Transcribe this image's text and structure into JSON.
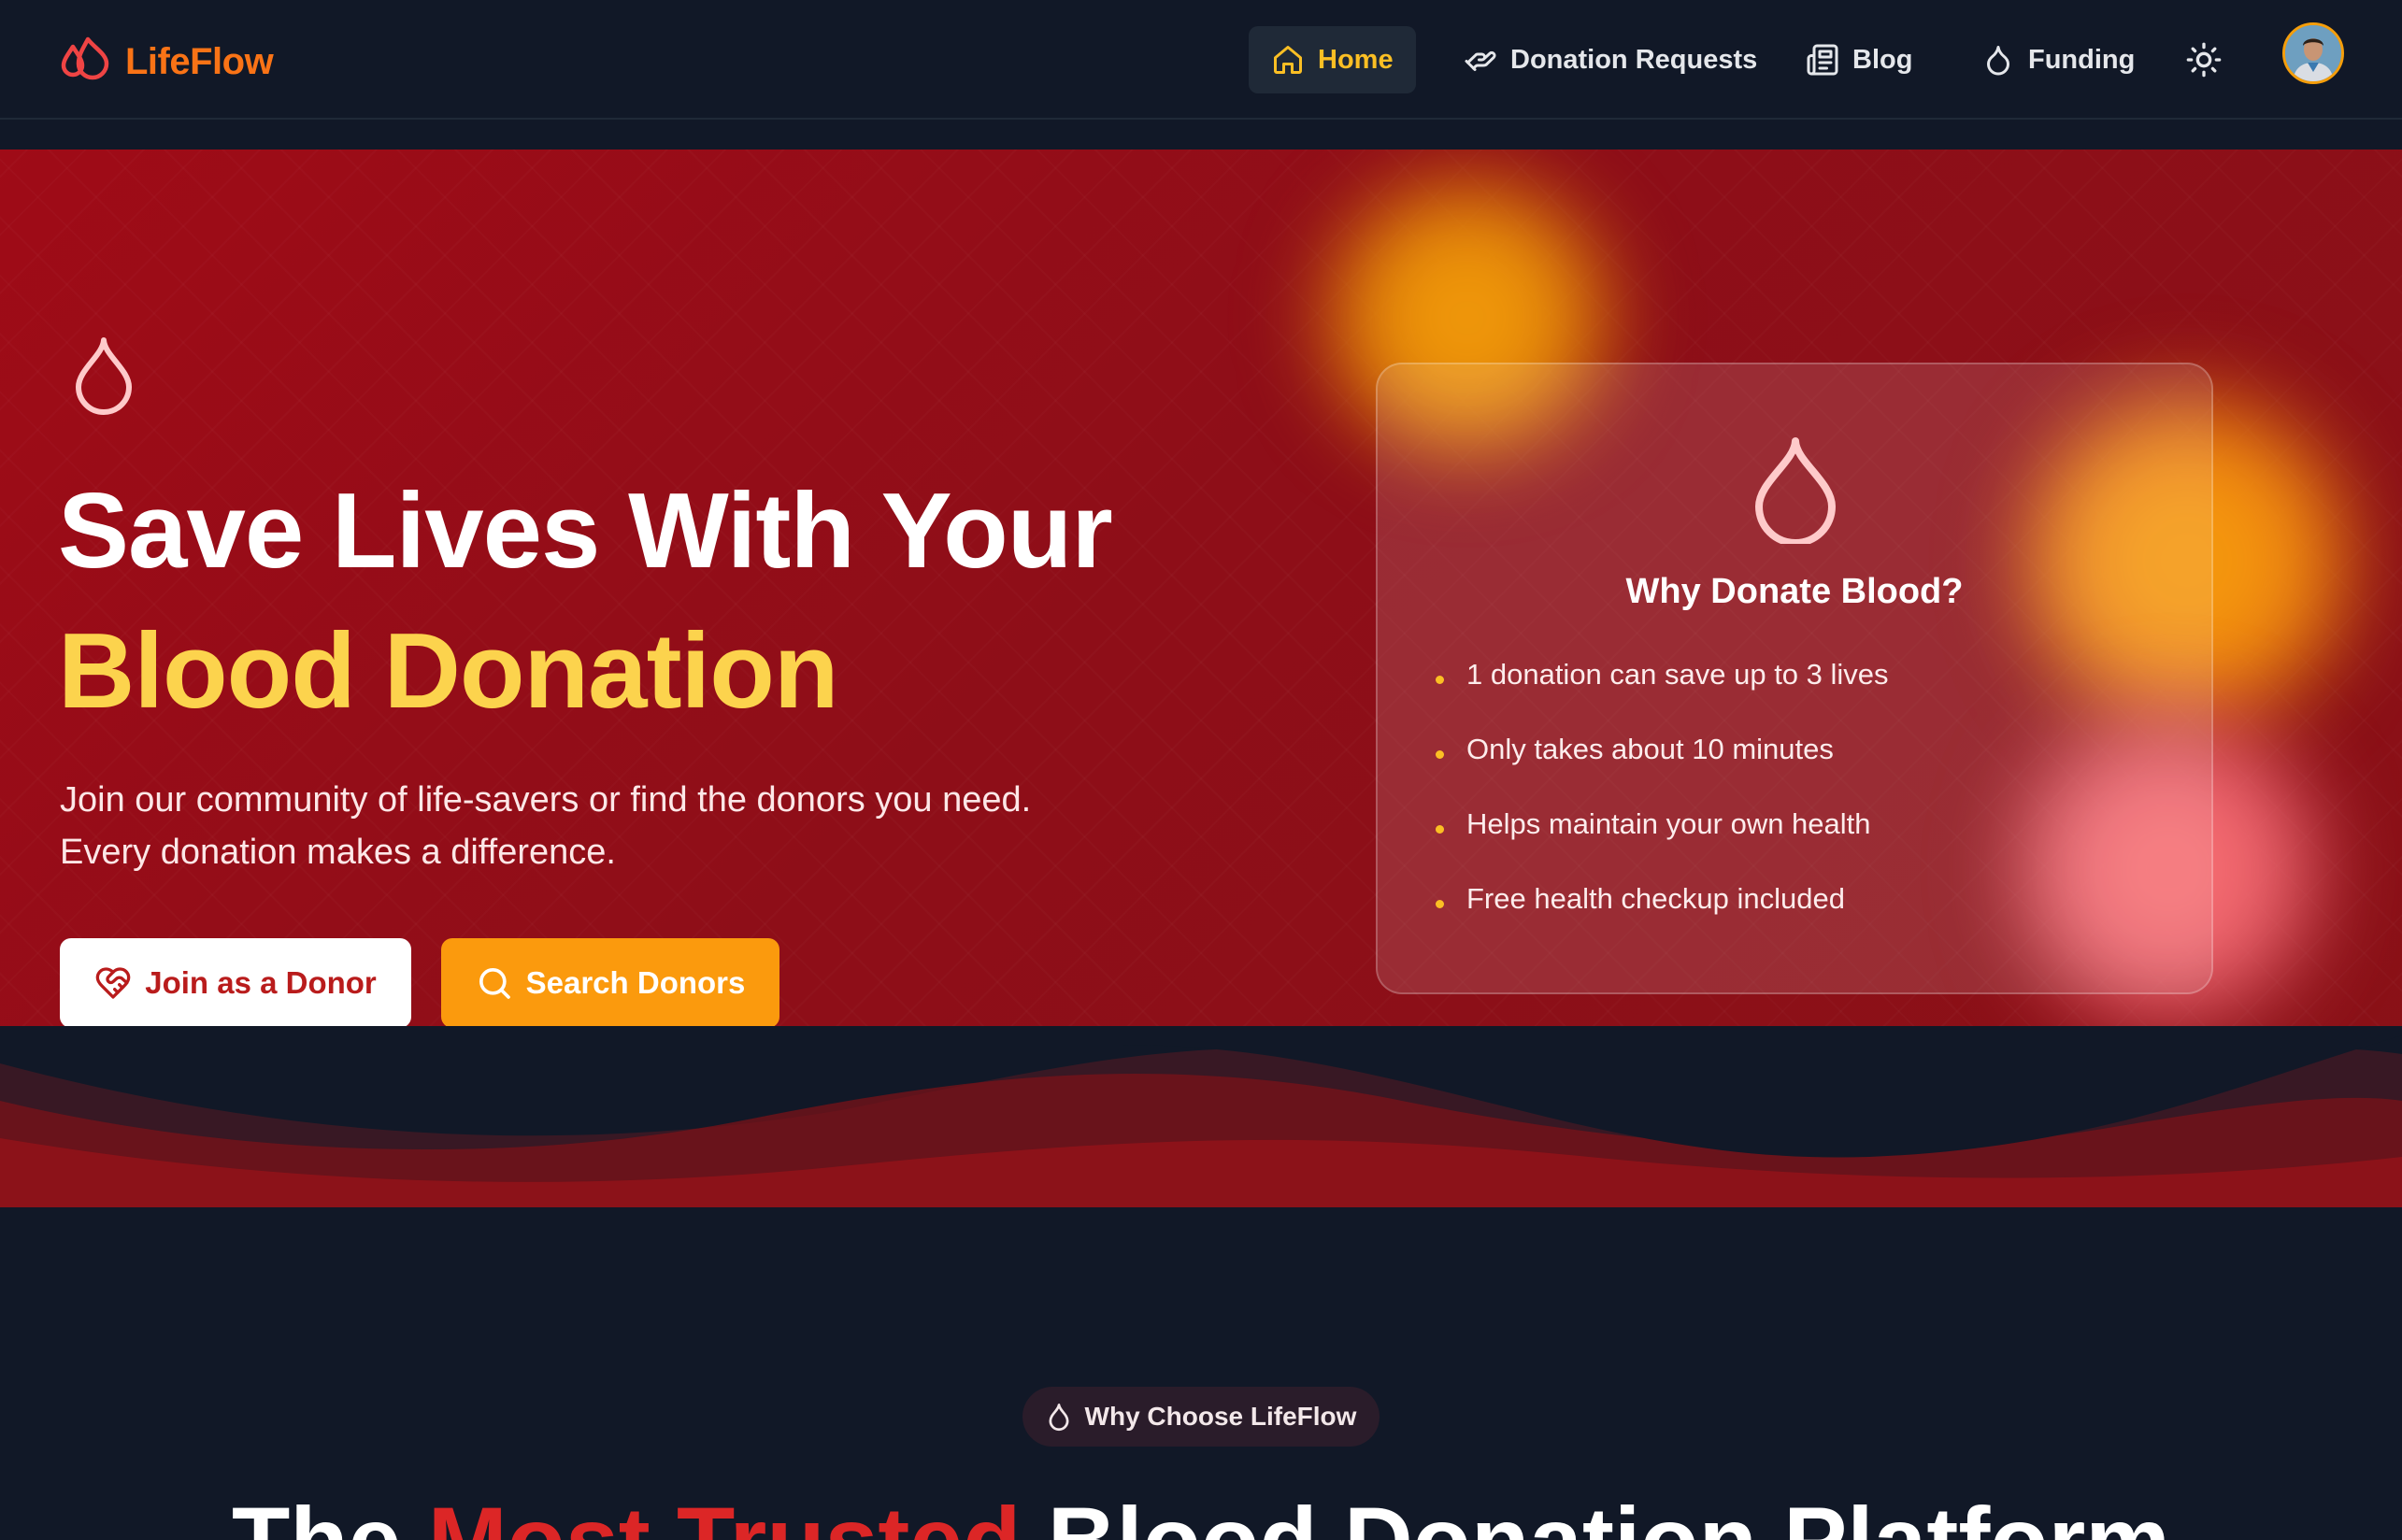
{
  "brand": {
    "name": "LifeFlow"
  },
  "nav": {
    "items": [
      {
        "label": "Home",
        "icon": "home-icon",
        "active": true
      },
      {
        "label": "Donation Requests",
        "icon": "helping-hand-icon",
        "active": false
      },
      {
        "label": "Blog",
        "icon": "newspaper-icon",
        "active": false
      },
      {
        "label": "Funding",
        "icon": "droplet-icon",
        "active": false
      }
    ],
    "theme_toggle_icon": "sun-icon",
    "avatar_icon": "user-avatar"
  },
  "hero": {
    "headline_line1": "Save Lives With Your",
    "headline_line2": "Blood Donation",
    "subtitle": "Join our community of life-savers or find the donors you need. Every donation makes a difference.",
    "join_button": "Join as a Donor",
    "search_button": "Search Donors",
    "card": {
      "title": "Why Donate Blood?",
      "items": [
        "1 donation can save up to 3 lives",
        "Only takes about 10 minutes",
        "Helps maintain your own health",
        "Free health checkup included"
      ]
    }
  },
  "section": {
    "badge": "Why Choose LifeFlow",
    "title_pre": "The ",
    "title_accent": "Most Trusted",
    "title_post": " Blood Donation Platform"
  },
  "colors": {
    "brand_orange": "#f97316",
    "hero_red": "#9f0b17",
    "accent_yellow": "#fcd34d",
    "button_orange": "#fb9a0d",
    "page_bg": "#111827"
  }
}
